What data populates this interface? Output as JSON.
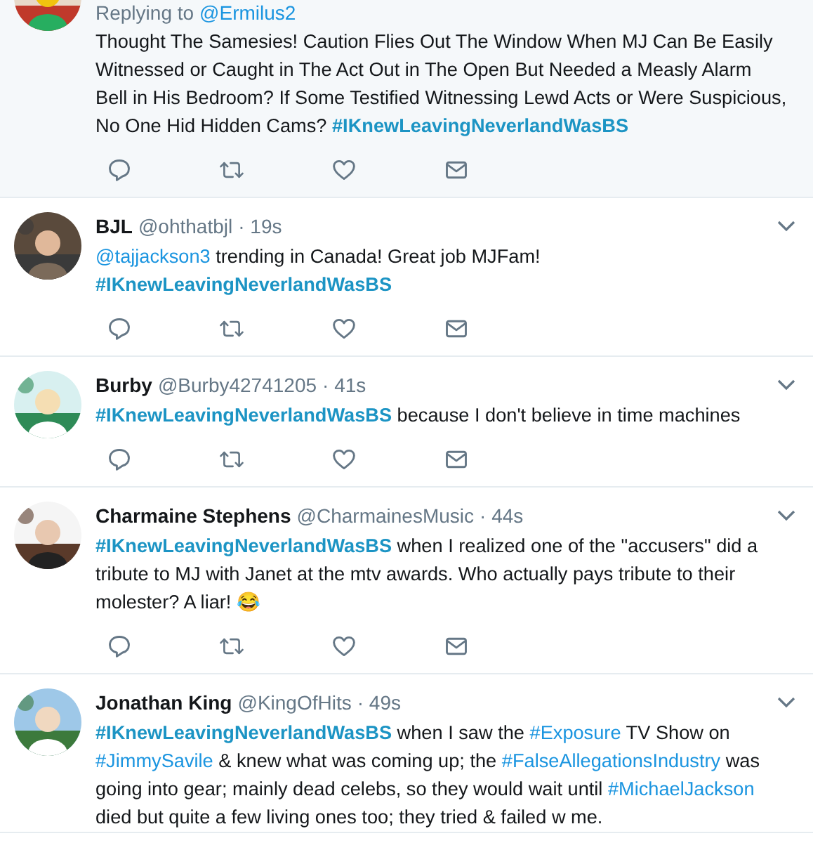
{
  "tweets": [
    {
      "highlighted": true,
      "reply_prefix": "Replying to",
      "reply_to": "@Ermilus2",
      "body": [
        {
          "kind": "text",
          "text": "Thought The Samesies! Caution Flies Out The Window When MJ Can Be Easily Witnessed or Caught in The Act Out in The Open But Needed a Measly Alarm Bell in His Bedroom? If Some Testified Witnessing Lewd Acts or Were Suspicious, No One Hid Hidden Cams?  "
        },
        {
          "kind": "hashtag_bold",
          "text": "#IKnewLeavingNeverlandWasBS"
        }
      ],
      "actions": true
    },
    {
      "highlighted": false,
      "name": "BJL",
      "handle": "@ohthatbjl",
      "time": "· 19s",
      "body": [
        {
          "kind": "link",
          "text": "@tajjackson3"
        },
        {
          "kind": "text",
          "text": " trending in Canada! Great job MJFam!"
        },
        {
          "kind": "break"
        },
        {
          "kind": "hashtag_bold",
          "text": "#IKnewLeavingNeverlandWasBS"
        }
      ],
      "actions": true
    },
    {
      "highlighted": false,
      "name": "Burby",
      "handle": "@Burby42741205",
      "time": "· 41s",
      "body": [
        {
          "kind": "hashtag_bold",
          "text": "#IKnewLeavingNeverlandWasBS"
        },
        {
          "kind": "text",
          "text": " because I don't believe in time machines"
        }
      ],
      "actions": true
    },
    {
      "highlighted": false,
      "name": "Charmaine Stephens",
      "handle": "@CharmainesMusic",
      "time": "· 44s",
      "body": [
        {
          "kind": "hashtag_bold",
          "text": "#IKnewLeavingNeverlandWasBS"
        },
        {
          "kind": "text",
          "text": " when I realized one of the \"accusers\" did a tribute to MJ with Janet at the mtv awards. Who actually pays tribute to their molester? A liar! 😂"
        }
      ],
      "actions": true
    },
    {
      "highlighted": false,
      "name": "Jonathan King",
      "handle": "@KingOfHits",
      "time": "· 49s",
      "body": [
        {
          "kind": "hashtag_bold",
          "text": "#IKnewLeavingNeverlandWasBS"
        },
        {
          "kind": "text",
          "text": " when I saw the "
        },
        {
          "kind": "link",
          "text": "#Exposure"
        },
        {
          "kind": "text",
          "text": " TV Show on "
        },
        {
          "kind": "link",
          "text": "#JimmySavile"
        },
        {
          "kind": "text",
          "text": " & knew what was coming up; the "
        },
        {
          "kind": "link",
          "text": "#FalseAllegationsIndustry"
        },
        {
          "kind": "text",
          "text": " was going into gear; mainly dead celebs, so they would wait until "
        },
        {
          "kind": "link",
          "text": "#MichaelJackson"
        },
        {
          "kind": "text",
          "text": " died but quite a few living ones too; they tried & failed w me."
        }
      ],
      "actions": false
    }
  ]
}
